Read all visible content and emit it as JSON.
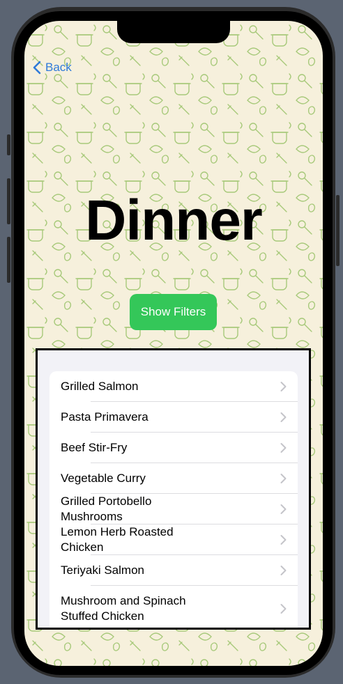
{
  "nav": {
    "back_label": "Back"
  },
  "header": {
    "title": "Dinner"
  },
  "filters": {
    "button_label": "Show Filters"
  },
  "colors": {
    "accent": "#2f7ad9",
    "button": "#34c759",
    "background": "#f6f0dc"
  },
  "recipes": [
    {
      "label": "Grilled Salmon"
    },
    {
      "label": "Pasta Primavera"
    },
    {
      "label": "Beef Stir-Fry"
    },
    {
      "label": "Vegetable Curry"
    },
    {
      "label": "Grilled Portobello Mushrooms"
    },
    {
      "label": "Lemon Herb Roasted Chicken"
    },
    {
      "label": "Teriyaki Salmon"
    },
    {
      "label": "Mushroom and Spinach Stuffed Chicken"
    }
  ]
}
